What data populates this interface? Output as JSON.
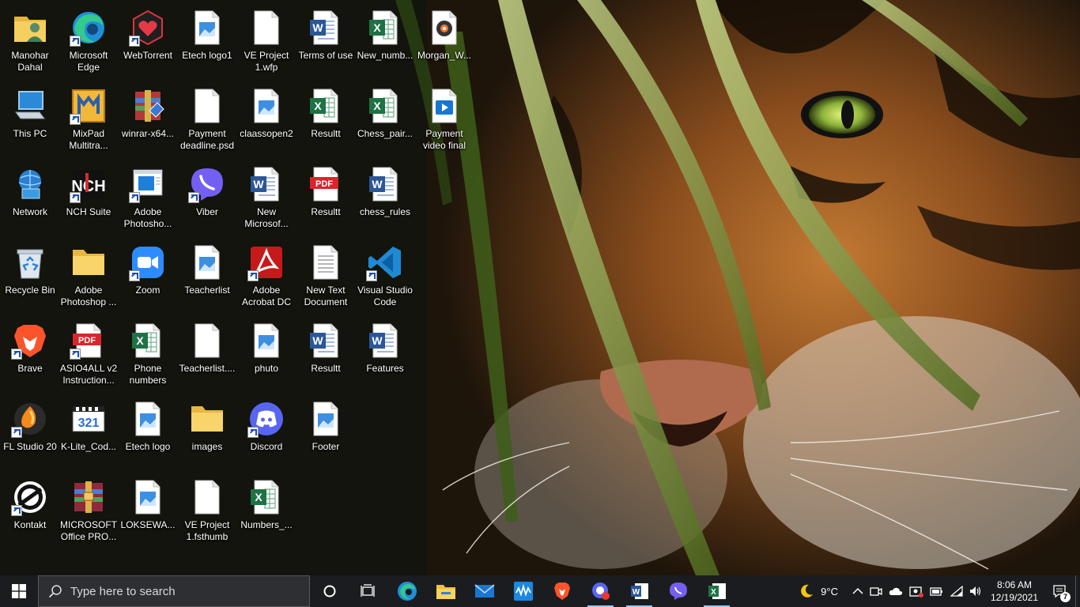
{
  "desktop": {
    "icons": [
      {
        "label": "Manohar Dahal",
        "icon": "user-folder-icon"
      },
      {
        "label": "Microsoft Edge",
        "icon": "edge-icon",
        "shortcut": true
      },
      {
        "label": "WebTorrent",
        "icon": "webtorrent-icon",
        "shortcut": true
      },
      {
        "label": "Etech logo1",
        "icon": "image-file-icon"
      },
      {
        "label": "VE Project 1.wfp",
        "icon": "blank-file-icon"
      },
      {
        "label": "Terms of use",
        "icon": "word-doc-icon"
      },
      {
        "label": "New_numb...",
        "icon": "excel-file-icon"
      },
      {
        "label": "Morgan_W...",
        "icon": "audio-file-icon"
      },
      {
        "label": "This PC",
        "icon": "this-pc-icon"
      },
      {
        "label": "MixPad Multitra...",
        "icon": "mixpad-icon",
        "shortcut": true
      },
      {
        "label": "winrar-x64...",
        "icon": "winrar-installer-icon"
      },
      {
        "label": "Payment deadline.psd",
        "icon": "blank-file-icon"
      },
      {
        "label": "claassopen2",
        "icon": "image-file-icon"
      },
      {
        "label": "Resultt",
        "icon": "excel-file-icon"
      },
      {
        "label": "Chess_pair...",
        "icon": "excel-file-icon"
      },
      {
        "label": "Payment video final",
        "icon": "video-file-icon"
      },
      {
        "label": "Network",
        "icon": "network-icon"
      },
      {
        "label": "NCH Suite",
        "icon": "nch-icon",
        "shortcut": true
      },
      {
        "label": "Adobe Photosho...",
        "icon": "window-shortcut-icon",
        "shortcut": true
      },
      {
        "label": "Viber",
        "icon": "viber-icon",
        "shortcut": true
      },
      {
        "label": "New Microsof...",
        "icon": "word-doc-icon"
      },
      {
        "label": "Resultt",
        "icon": "pdf-file-icon"
      },
      {
        "label": "chess_rules",
        "icon": "word-doc-icon"
      },
      {
        "label": "Recycle Bin",
        "icon": "recycle-bin-icon"
      },
      {
        "label": "Adobe Photoshop ...",
        "icon": "folder-icon"
      },
      {
        "label": "Zoom",
        "icon": "zoom-icon",
        "shortcut": true
      },
      {
        "label": "Teacherlist",
        "icon": "image-file-icon"
      },
      {
        "label": "Adobe Acrobat DC",
        "icon": "acrobat-icon",
        "shortcut": true
      },
      {
        "label": "New Text Document",
        "icon": "text-file-icon"
      },
      {
        "label": "Visual Studio Code",
        "icon": "vscode-icon",
        "shortcut": true
      },
      {
        "label": "Brave",
        "icon": "brave-icon",
        "shortcut": true
      },
      {
        "label": "ASIO4ALL v2 Instruction...",
        "icon": "pdf-file-icon",
        "shortcut": true
      },
      {
        "label": "Phone numbers",
        "icon": "excel-file-icon"
      },
      {
        "label": "Teacherlist....",
        "icon": "blank-file-icon"
      },
      {
        "label": "phuto",
        "icon": "image-file-icon"
      },
      {
        "label": "Resultt",
        "icon": "word-doc-icon"
      },
      {
        "label": "Features",
        "icon": "word-doc-icon"
      },
      {
        "label": "FL Studio 20",
        "icon": "fl-studio-icon",
        "shortcut": true
      },
      {
        "label": "K-Lite_Cod...",
        "icon": "klite-icon"
      },
      {
        "label": "Etech logo",
        "icon": "image-file-icon"
      },
      {
        "label": "images",
        "icon": "folder-icon"
      },
      {
        "label": "Discord",
        "icon": "discord-icon",
        "shortcut": true
      },
      {
        "label": "Footer",
        "icon": "image-file-icon"
      },
      {
        "label": "Kontakt",
        "icon": "kontakt-icon",
        "shortcut": true
      },
      {
        "label": "MICROSOFT Office PRO...",
        "icon": "winrar-archive-icon"
      },
      {
        "label": "LOKSEWA...",
        "icon": "image-file-icon"
      },
      {
        "label": "VE Project 1.fsthumb",
        "icon": "blank-file-icon"
      },
      {
        "label": "Numbers_...",
        "icon": "excel-file-icon"
      }
    ]
  },
  "taskbar": {
    "search_placeholder": "Type here to search",
    "pinned": [
      {
        "name": "cortana",
        "icon": "cortana-icon"
      },
      {
        "name": "task-view",
        "icon": "task-view-icon"
      },
      {
        "name": "edge",
        "icon": "edge-icon"
      },
      {
        "name": "file-explorer",
        "icon": "file-explorer-icon"
      },
      {
        "name": "mail",
        "icon": "mail-icon"
      },
      {
        "name": "waves",
        "icon": "waves-icon"
      },
      {
        "name": "brave",
        "icon": "brave-icon"
      },
      {
        "name": "record",
        "icon": "record-icon"
      },
      {
        "name": "word",
        "icon": "word-icon"
      },
      {
        "name": "viber",
        "icon": "viber-icon"
      },
      {
        "name": "excel",
        "icon": "excel-icon"
      }
    ],
    "tray": {
      "weather": "9°C",
      "time": "8:06 AM",
      "date": "12/19/2021",
      "notification_count": "7"
    }
  },
  "colors": {
    "taskbar_bg": "#1b1c1f",
    "search_bg": "#2d2f33",
    "accent": "#9ec6f0"
  }
}
